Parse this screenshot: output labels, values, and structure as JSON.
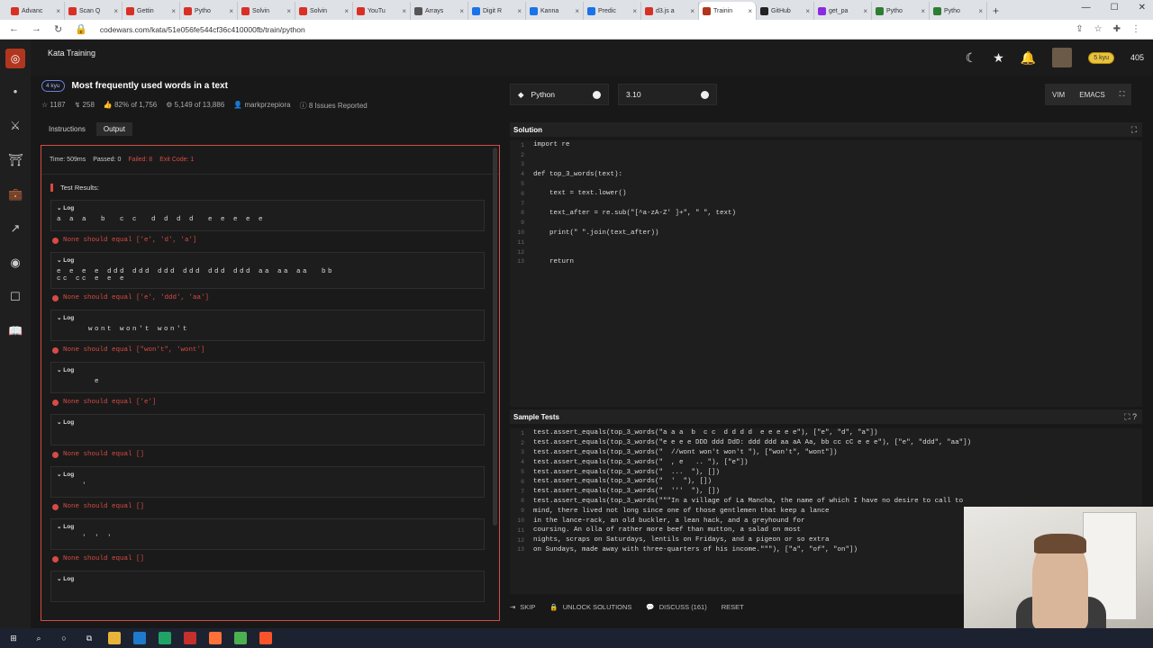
{
  "browser": {
    "tabs": [
      {
        "label": "Advanc",
        "color": "#d93025"
      },
      {
        "label": "Scan Q",
        "color": "#d93025"
      },
      {
        "label": "Gettin",
        "color": "#d93025"
      },
      {
        "label": "Pytho",
        "color": "#d93025"
      },
      {
        "label": "Solvin",
        "color": "#d93025"
      },
      {
        "label": "Solvin",
        "color": "#d93025"
      },
      {
        "label": "YouTu",
        "color": "#d93025"
      },
      {
        "label": "Arrays",
        "color": "#555555"
      },
      {
        "label": "Digit R",
        "color": "#1a73e8"
      },
      {
        "label": "Kanna",
        "color": "#1a73e8"
      },
      {
        "label": "Predic",
        "color": "#1a73e8"
      },
      {
        "label": "d3.js a",
        "color": "#d93025"
      },
      {
        "label": "Trainin",
        "color": "#b1361e"
      },
      {
        "label": "GitHub",
        "color": "#222222"
      },
      {
        "label": "get_pa",
        "color": "#8a2be2"
      },
      {
        "label": "Pytho",
        "color": "#2e7d32"
      },
      {
        "label": "Pytho",
        "color": "#2e7d32"
      }
    ],
    "new_tab": "+",
    "url": "codewars.com/kata/51e056fe544cf36c410000fb/train/python"
  },
  "header": {
    "breadcrumb": "Kata Training",
    "rank_badge": "5 kyu",
    "honor": "405"
  },
  "kata": {
    "kyu": "4 kyu",
    "title": "Most frequently used words in a text",
    "stars": "1187",
    "bookmarks": "258",
    "satisfaction": "82% of 1,756",
    "completed": "5,149 of 13,886",
    "author": "markprzepiora",
    "issues": "8 Issues Reported"
  },
  "left_tabs": {
    "instructions": "Instructions",
    "output": "Output"
  },
  "output": {
    "time": "Time: 509ms",
    "passed": "Passed: 0",
    "failed": "Failed: 8",
    "exit": "Exit Code: 1",
    "results_title": "Test Results:",
    "log_label": "Log",
    "entries": [
      {
        "log": "a a a  b  c c  d d d d  e e e e e",
        "error": "None should equal ['e', 'd', 'a']"
      },
      {
        "log": "e e e e ddd ddd ddd ddd ddd ddd aa aa aa  bb\ncc cc e e e",
        "error": "None should equal ['e', 'ddd', 'aa']"
      },
      {
        "log": "     wont won't won't",
        "error": "None should equal [\"won't\", 'wont']"
      },
      {
        "log": "      e",
        "error": "None should equal ['e']"
      },
      {
        "log": "",
        "error": "None should equal []"
      },
      {
        "log": "    '",
        "error": "None should equal []"
      },
      {
        "log": "    ' ' '",
        "error": "None should equal []"
      },
      {
        "log": "",
        "error": ""
      }
    ]
  },
  "editor": {
    "language": "Python",
    "version": "3.10",
    "modes": [
      "VIM",
      "EMACS"
    ],
    "solution_title": "Solution",
    "solution_lines": [
      "import re",
      "",
      "",
      "def top_3_words(text):",
      "",
      "    text = text.lower()",
      "",
      "    text_after = re.sub(\"[^a-zA-Z' ]+\", \" \", text)",
      "",
      "    print(\" \".join(text_after))",
      "",
      "",
      "    return"
    ],
    "tests_title": "Sample Tests",
    "test_lines": [
      "test.assert_equals(top_3_words(\"a a a  b  c c  d d d d  e e e e e\"), [\"e\", \"d\", \"a\"])",
      "test.assert_equals(top_3_words(\"e e e e DDD ddd DdD: ddd ddd aa aA Aa, bb cc cC e e e\"), [\"e\", \"ddd\", \"aa\"])",
      "test.assert_equals(top_3_words(\"  //wont won't won't \"), [\"won't\", \"wont\"])",
      "test.assert_equals(top_3_words(\"  , e   .. \"), [\"e\"])",
      "test.assert_equals(top_3_words(\"  ...  \"), [])",
      "test.assert_equals(top_3_words(\"  '  \"), [])",
      "test.assert_equals(top_3_words(\"  '''  \"), [])",
      "test.assert_equals(top_3_words(\"\"\"In a village of La Mancha, the name of which I have no desire to call to",
      "mind, there lived not long since one of those gentlemen that keep a lance",
      "in the lance-rack, an old buckler, a lean hack, and a greyhound for",
      "coursing. An olla of rather more beef than mutton, a salad on most",
      "nights, scraps on Saturdays, lentils on Fridays, and a pigeon or so extra",
      "on Sundays, made away with three-quarters of his income.\"\"\"), [\"a\", \"of\", \"on\"])"
    ],
    "actions": {
      "skip": "SKIP",
      "unlock": "UNLOCK SOLUTIONS",
      "discuss": "DISCUSS (161)",
      "reset": "RESET"
    }
  }
}
